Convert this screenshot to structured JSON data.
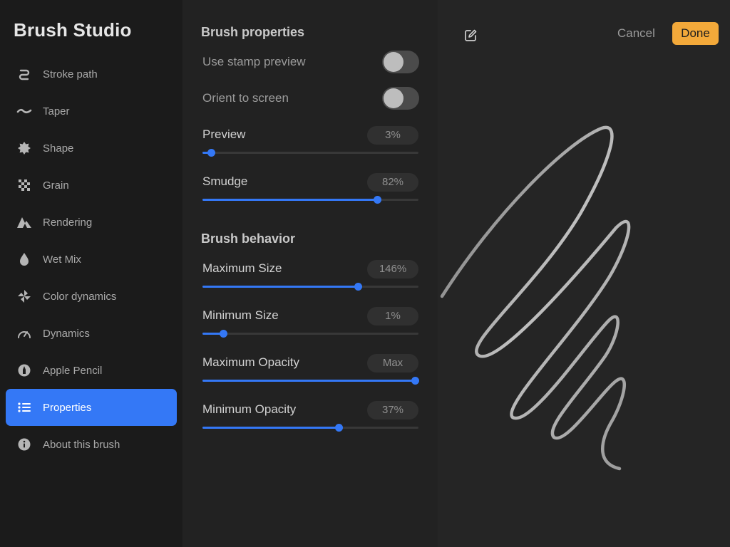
{
  "app_title": "Brush Studio",
  "sidebar": {
    "items": [
      {
        "label": "Stroke path",
        "icon": "stroke-path-icon"
      },
      {
        "label": "Taper",
        "icon": "taper-icon"
      },
      {
        "label": "Shape",
        "icon": "shape-icon"
      },
      {
        "label": "Grain",
        "icon": "grain-icon"
      },
      {
        "label": "Rendering",
        "icon": "rendering-icon"
      },
      {
        "label": "Wet Mix",
        "icon": "wet-mix-icon"
      },
      {
        "label": "Color dynamics",
        "icon": "color-dynamics-icon"
      },
      {
        "label": "Dynamics",
        "icon": "dynamics-icon"
      },
      {
        "label": "Apple Pencil",
        "icon": "apple-pencil-icon"
      },
      {
        "label": "Properties",
        "icon": "properties-icon",
        "active": true
      },
      {
        "label": "About this brush",
        "icon": "info-icon"
      }
    ]
  },
  "brush_properties": {
    "title": "Brush properties",
    "use_stamp_preview": {
      "label": "Use stamp preview",
      "on": false
    },
    "orient_to_screen": {
      "label": "Orient to screen",
      "on": false
    },
    "preview": {
      "label": "Preview",
      "value": "3%",
      "level": 0.04
    },
    "smudge": {
      "label": "Smudge",
      "value": "82%",
      "level": 0.81
    }
  },
  "brush_behavior": {
    "title": "Brush behavior",
    "maximum_size": {
      "label": "Maximum Size",
      "value": "146%",
      "level": 0.72
    },
    "minimum_size": {
      "label": "Minimum Size",
      "value": "1%",
      "level": 0.095
    },
    "maximum_opacity": {
      "label": "Maximum Opacity",
      "value": "Max",
      "level": 0.985
    },
    "minimum_opacity": {
      "label": "Minimum Opacity",
      "value": "37%",
      "level": 0.63
    }
  },
  "pad": {
    "cancel_label": "Cancel",
    "done_label": "Done",
    "accent_color": "#f3a93a"
  },
  "colors": {
    "accent": "#3478f6",
    "done_button": "#f3a93a"
  }
}
